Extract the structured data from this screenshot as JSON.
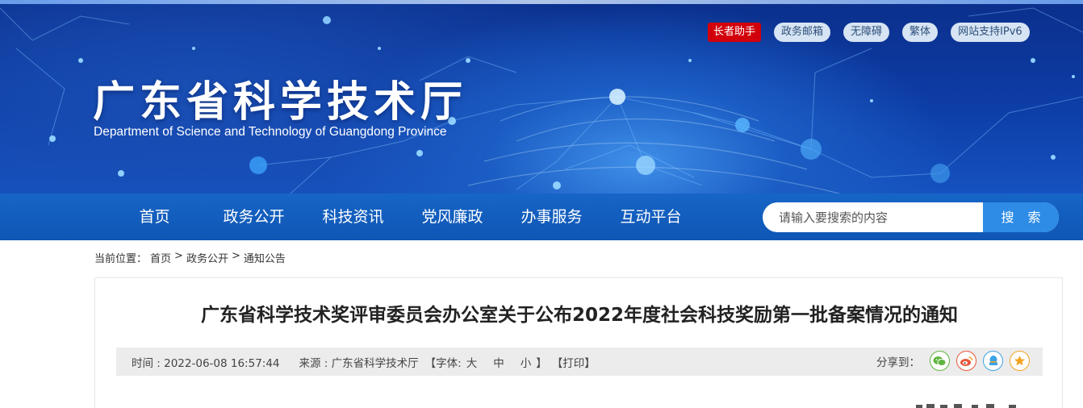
{
  "header": {
    "title": "广东省科学技术厅",
    "subtitle": "Department of Science and Technology of Guangdong Province",
    "top_links": [
      "长者助手",
      "政务邮箱",
      "无障碍",
      "繁体",
      "网站支持IPv6"
    ]
  },
  "nav": {
    "items": [
      "首页",
      "政务公开",
      "科技资讯",
      "党风廉政",
      "办事服务",
      "互动平台"
    ],
    "search_placeholder": "请输入要搜索的内容",
    "search_button": "搜 索"
  },
  "breadcrumb": {
    "label": "当前位置：",
    "items": [
      "首页",
      "政务公开",
      "通知公告"
    ],
    "separator": ">"
  },
  "article": {
    "title": "广东省科学技术奖评审委员会办公室关于公布2022年度社会科技奖励第一批备案情况的通知",
    "time": "时间 : 2022-06-08 16:57:44",
    "source": "来源 : 广东省科学技术厅",
    "font_label": "【字体:",
    "font_sizes": [
      "大",
      "中",
      "小"
    ],
    "font_close": "】",
    "print": "【打印】",
    "share_label": "分享到：",
    "share_icons": [
      "wechat-icon",
      "weibo-icon",
      "qq-icon",
      "favorite-icon"
    ]
  },
  "colors": {
    "banner_dark": "#0b2f8c",
    "nav_blue": "#1665c6",
    "search_button": "#2e8ce6",
    "elder_button": "#d1000b"
  }
}
